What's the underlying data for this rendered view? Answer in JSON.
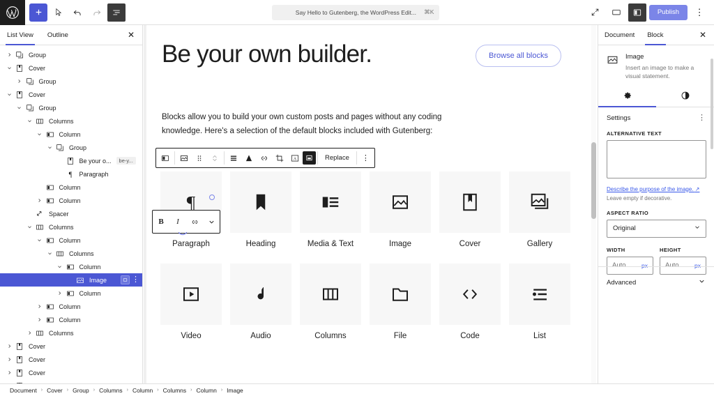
{
  "topbar": {
    "logo": "wordpress-logo",
    "buttons": [
      {
        "name": "add-block-button",
        "icon": "plus-icon",
        "label": "+"
      },
      {
        "name": "tools-button",
        "icon": "cursor-icon",
        "label": ""
      },
      {
        "name": "undo-button",
        "icon": "undo-arrow-icon",
        "label": ""
      },
      {
        "name": "redo-button",
        "icon": "redo-arrow-icon",
        "label": ""
      },
      {
        "name": "list-view-button",
        "icon": "list-view-icon",
        "label": ""
      }
    ],
    "command_bar": {
      "text": "Say Hello to Gutenberg, the WordPress Edit...",
      "shortcut": "⌘K"
    },
    "right_buttons": [
      {
        "name": "fullscreen-button",
        "icon": "expand-icon"
      },
      {
        "name": "preview-button",
        "icon": "device-preview-icon"
      },
      {
        "name": "settings-sidebar-button",
        "icon": "sidebar-panel-icon"
      }
    ],
    "publish_label": "Publish",
    "options_label": "⋮"
  },
  "listview": {
    "tabs": [
      {
        "label": "List View",
        "active": true
      },
      {
        "label": "Outline",
        "active": false
      }
    ],
    "close_label": "✕",
    "rows": [
      {
        "label": "Group",
        "icon": "group-icon",
        "depth": 0,
        "caret": "right"
      },
      {
        "label": "Cover",
        "icon": "cover-icon",
        "depth": 0,
        "caret": "down"
      },
      {
        "label": "Group",
        "icon": "group-icon",
        "depth": 1,
        "caret": "right"
      },
      {
        "label": "Cover",
        "icon": "cover-icon",
        "depth": 0,
        "caret": "down"
      },
      {
        "label": "Group",
        "icon": "group-icon",
        "depth": 1,
        "caret": "down"
      },
      {
        "label": "Columns",
        "icon": "columns-icon",
        "depth": 2,
        "caret": "down"
      },
      {
        "label": "Column",
        "icon": "column-icon",
        "depth": 3,
        "caret": "down"
      },
      {
        "label": "Group",
        "icon": "group-icon",
        "depth": 4,
        "caret": "down"
      },
      {
        "label": "Be your o...",
        "icon": "cover-icon",
        "depth": 5,
        "caret": "none",
        "badge": "be-y..."
      },
      {
        "label": "Paragraph",
        "icon": "paragraph-icon",
        "depth": 5,
        "caret": "none"
      },
      {
        "label": "Column",
        "icon": "column-icon",
        "depth": 3,
        "caret": "none"
      },
      {
        "label": "Column",
        "icon": "column-icon",
        "depth": 3,
        "caret": "right"
      },
      {
        "label": "Spacer",
        "icon": "spacer-icon",
        "depth": 2,
        "caret": "none"
      },
      {
        "label": "Columns",
        "icon": "columns-icon",
        "depth": 2,
        "caret": "down"
      },
      {
        "label": "Column",
        "icon": "column-icon",
        "depth": 3,
        "caret": "down"
      },
      {
        "label": "Columns",
        "icon": "columns-icon",
        "depth": 4,
        "caret": "down"
      },
      {
        "label": "Column",
        "icon": "column-icon",
        "depth": 5,
        "caret": "down"
      },
      {
        "label": "Image",
        "icon": "image-icon",
        "depth": 6,
        "caret": "none",
        "selected": true
      },
      {
        "label": "Column",
        "icon": "column-icon",
        "depth": 5,
        "caret": "right"
      },
      {
        "label": "Column",
        "icon": "column-icon",
        "depth": 3,
        "caret": "right"
      },
      {
        "label": "Column",
        "icon": "column-icon",
        "depth": 3,
        "caret": "right"
      },
      {
        "label": "Columns",
        "icon": "columns-icon",
        "depth": 2,
        "caret": "right"
      },
      {
        "label": "Cover",
        "icon": "cover-icon",
        "depth": 0,
        "caret": "right"
      },
      {
        "label": "Cover",
        "icon": "cover-icon",
        "depth": 0,
        "caret": "right"
      },
      {
        "label": "Cover",
        "icon": "cover-icon",
        "depth": 0,
        "caret": "right"
      },
      {
        "label": "Cover",
        "icon": "cover-icon",
        "depth": 0,
        "caret": "right"
      }
    ],
    "selected_row_actions": {
      "thumb": "image-thumb",
      "more": "⋮"
    }
  },
  "canvas": {
    "title": "Be your own builder.",
    "browse_all_blocks": "Browse all blocks",
    "paragraph": "Blocks allow you to build your own custom posts and pages without any coding knowledge. Here's a selection of the default blocks included with Gutenberg:",
    "block_toolbar": {
      "parent_icon": "column-parent-icon",
      "block_type_icon": "image-icon",
      "drag_icon": "drag-handle-icon",
      "mover_icon": "up-down-mover-icon",
      "align_icon": "align-icon",
      "filter_icon": "duotone-filter-icon",
      "link_icon": "link-icon",
      "crop_icon": "crop-icon",
      "text_over_icon": "add-text-over-image-icon",
      "selected_icon": "image-fill-icon",
      "replace_label": "Replace",
      "more_label": "⋮"
    },
    "inline_toolbar": {
      "bold": "B",
      "italic": "I",
      "link": "link-icon",
      "more": "chevron-down-icon"
    },
    "blocks": [
      [
        {
          "label": "Paragraph",
          "icon": "paragraph-icon"
        },
        {
          "label": "Heading",
          "icon": "heading-bookmark-icon"
        },
        {
          "label": "Media & Text",
          "icon": "media-text-icon"
        },
        {
          "label": "Image",
          "icon": "image-icon"
        },
        {
          "label": "Cover",
          "icon": "cover-icon"
        },
        {
          "label": "Gallery",
          "icon": "gallery-icon"
        }
      ],
      [
        {
          "label": "Video",
          "icon": "video-icon"
        },
        {
          "label": "Audio",
          "icon": "audio-note-icon"
        },
        {
          "label": "Columns",
          "icon": "columns-icon"
        },
        {
          "label": "File",
          "icon": "file-folder-icon"
        },
        {
          "label": "Code",
          "icon": "code-icon"
        },
        {
          "label": "List",
          "icon": "list-icon"
        }
      ]
    ]
  },
  "inspector": {
    "tabs": [
      {
        "label": "Document",
        "active": false
      },
      {
        "label": "Block",
        "active": true
      }
    ],
    "close_label": "✕",
    "block_card": {
      "icon": "image-icon",
      "title": "Image",
      "description": "Insert an image to make a visual statement."
    },
    "section_tabs": [
      {
        "name": "settings-tab",
        "icon": "gear-icon",
        "active": true
      },
      {
        "name": "styles-tab",
        "icon": "contrast-icon",
        "active": false
      }
    ],
    "settings": {
      "title": "Settings",
      "more": "⋮",
      "alt_text_label": "Alternative text",
      "alt_text_value": "",
      "alt_text_placeholder": "",
      "help_link": "Describe the purpose of the image.",
      "help_link_icon": "external-link-icon",
      "help_text": "Leave empty if decorative.",
      "aspect_ratio_label": "Aspect ratio",
      "aspect_ratio_value": "Original",
      "width_label": "Width",
      "width_placeholder": "Auto",
      "width_unit": "px",
      "height_label": "Height",
      "height_placeholder": "Auto",
      "height_unit": "px"
    },
    "advanced": {
      "title": "Advanced",
      "icon": "chevron-down-icon"
    }
  },
  "breadcrumb": {
    "items": [
      "Document",
      "Cover",
      "Group",
      "Columns",
      "Column",
      "Columns",
      "Column",
      "Image"
    ],
    "separator": "›"
  },
  "colors": {
    "accent": "#4b57d4",
    "publish": "#7b85e8",
    "link": "#3858e9",
    "text": "#1e1e1e",
    "muted": "#757575",
    "tile": "#f7f7f7"
  }
}
